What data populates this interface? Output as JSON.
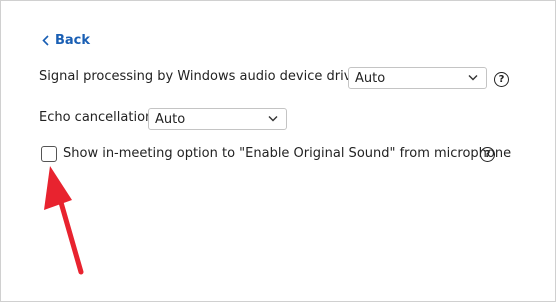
{
  "back": {
    "label": "Back"
  },
  "signal_processing": {
    "label": "Signal processing by Windows audio device drivers",
    "value": "Auto"
  },
  "echo_cancellation": {
    "label": "Echo cancellation",
    "value": "Auto"
  },
  "original_sound_option": {
    "label": "Show in-meeting option to \"Enable Original Sound\" from microphone",
    "checked": false
  },
  "help_icon_glyph": "?",
  "annotation": {
    "arrow_color": "#e8232f"
  }
}
